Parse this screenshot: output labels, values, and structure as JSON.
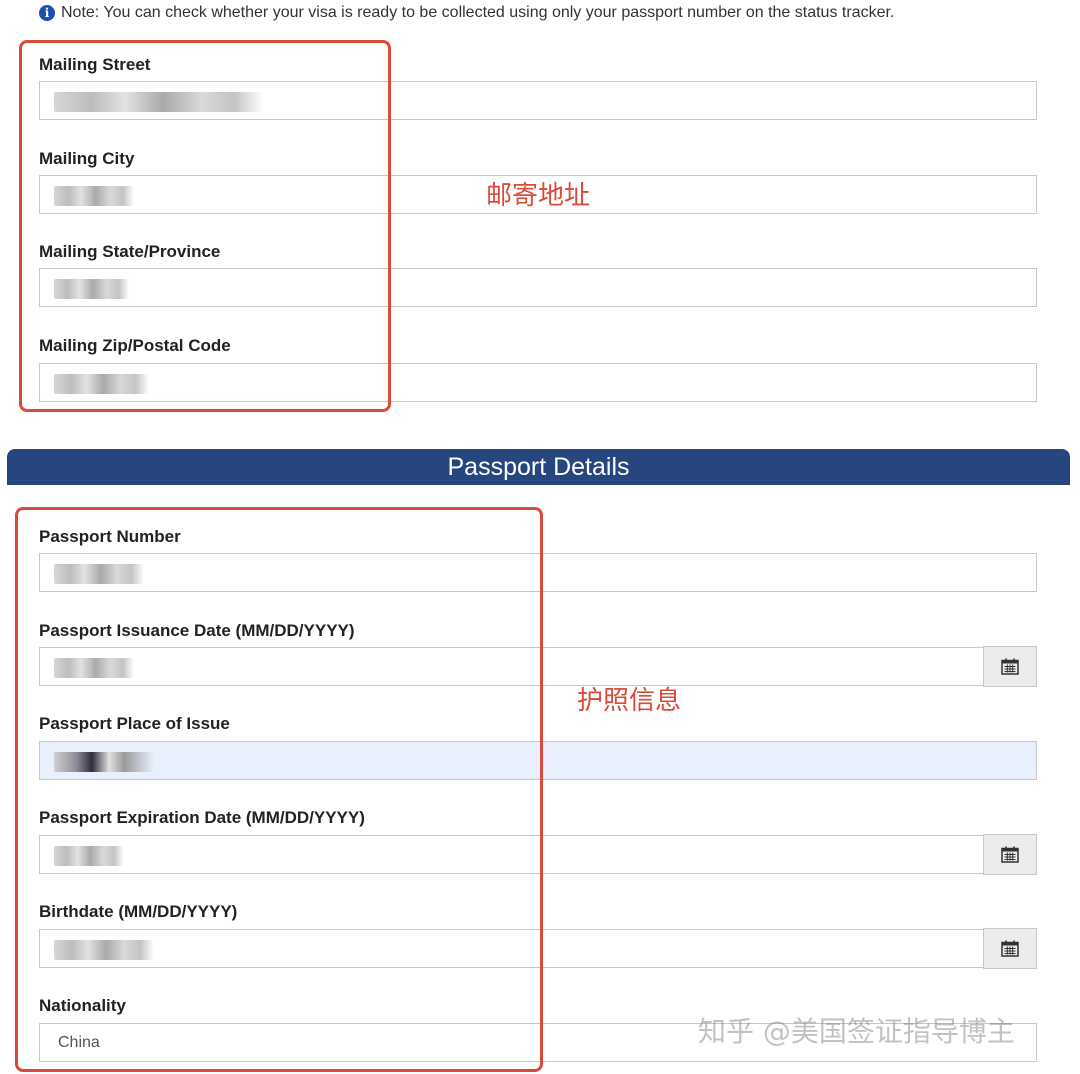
{
  "note": {
    "text": "Note: You can check whether your visa is ready to be collected using only your passport number on the status tracker."
  },
  "mailing": {
    "street_label": "Mailing Street",
    "city_label": "Mailing City",
    "state_label": "Mailing State/Province",
    "zip_label": "Mailing Zip/Postal Code"
  },
  "annotations": {
    "mailing": "邮寄地址",
    "passport": "护照信息"
  },
  "passport_section": {
    "title": "Passport Details",
    "number_label": "Passport Number",
    "issuance_label": "Passport Issuance Date (MM/DD/YYYY)",
    "place_label": "Passport Place of Issue",
    "expiration_label": "Passport Expiration Date (MM/DD/YYYY)",
    "birthdate_label": "Birthdate (MM/DD/YYYY)",
    "nationality_label": "Nationality",
    "nationality_value": "China"
  },
  "watermark": "知乎 @美国签证指导博主",
  "colors": {
    "section_bar": "#27467d",
    "annotation_red": "#d94b3a",
    "highlight_field": "#e8f0fe"
  },
  "icons": {
    "info": "info-icon",
    "calendar": "calendar-icon"
  }
}
